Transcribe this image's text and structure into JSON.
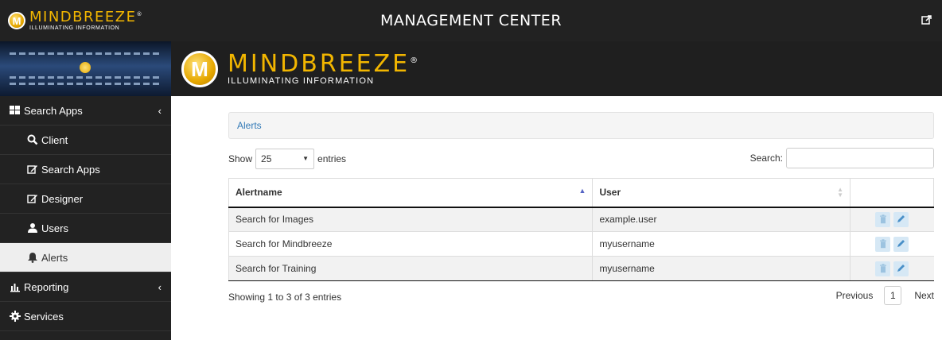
{
  "header": {
    "logo_word": "MINDBREEZE",
    "logo_reg": "®",
    "logo_tagline": "ILLUMINATING INFORMATION",
    "logo_letter": "M",
    "title": "MANAGEMENT CENTER",
    "external_link_icon": "external-link-icon"
  },
  "banner": {
    "logo_word": "MINDBREEZE",
    "logo_reg": "®",
    "logo_tagline": "ILLUMINATING INFORMATION",
    "logo_letter": "M"
  },
  "sidebar": {
    "items": [
      {
        "label": "Search Apps",
        "icon": "th-large-icon",
        "level": "top",
        "caret": "‹"
      },
      {
        "label": "Client",
        "icon": "search-icon",
        "level": "sub"
      },
      {
        "label": "Search Apps",
        "icon": "edit-icon",
        "level": "sub"
      },
      {
        "label": "Designer",
        "icon": "edit-icon",
        "level": "sub"
      },
      {
        "label": "Users",
        "icon": "user-icon",
        "level": "sub"
      },
      {
        "label": "Alerts",
        "icon": "bell-icon",
        "level": "sub",
        "active": true
      },
      {
        "label": "Reporting",
        "icon": "bar-chart-icon",
        "level": "top",
        "caret": "‹"
      },
      {
        "label": "Services",
        "icon": "gear-icon",
        "level": "top"
      }
    ]
  },
  "breadcrumb": {
    "label": "Alerts"
  },
  "table_controls": {
    "show_label": "Show",
    "length_value": "25",
    "entries_label": "entries",
    "search_label": "Search:",
    "search_value": ""
  },
  "table": {
    "columns": [
      "Alertname",
      "User",
      ""
    ],
    "rows": [
      {
        "alertname": "Search for Images",
        "user": "example.user"
      },
      {
        "alertname": "Search for Mindbreeze",
        "user": "myusername"
      },
      {
        "alertname": "Search for Training",
        "user": "myusername"
      }
    ]
  },
  "footer": {
    "info": "Showing 1 to 3 of 3 entries",
    "previous": "Previous",
    "current_page": "1",
    "next": "Next"
  },
  "colors": {
    "topbar": "#222222",
    "brand_yellow": "#f2b600",
    "link": "#337ab7",
    "action_bg": "#d6e8f5"
  }
}
